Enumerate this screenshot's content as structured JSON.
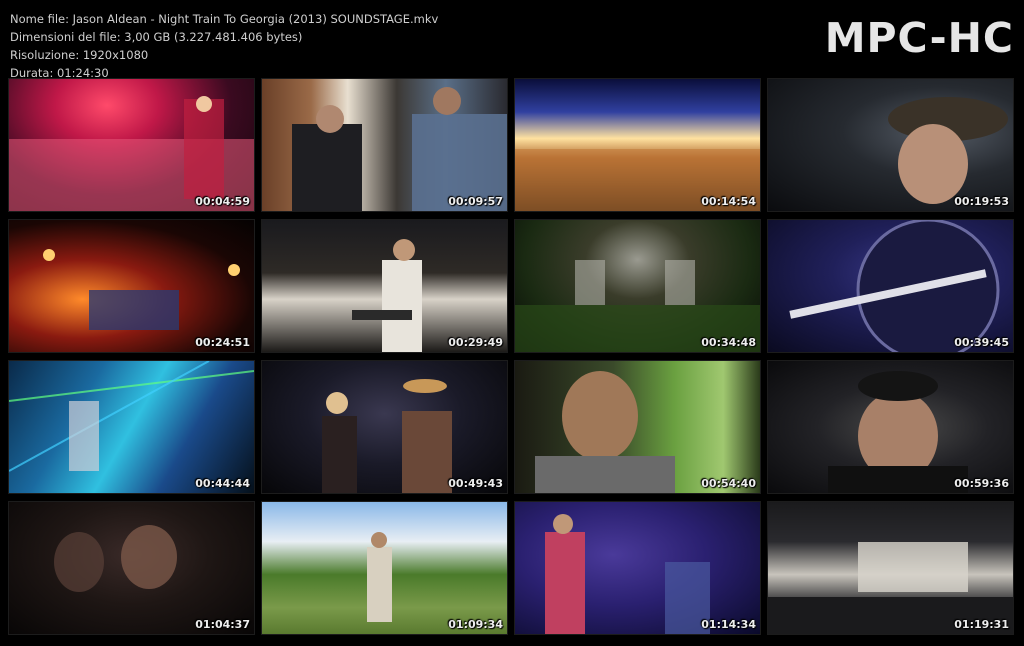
{
  "file_info": {
    "name": "Nome file: Jason Aldean - Night Train To Georgia (2013) SOUNDSTAGE.mkv",
    "size": "Dimensioni del file: 3,00 GB (3.227.481.406 bytes)",
    "resolution": "Risoluzione: 1920x1080",
    "duration": "Durata: 01:24:30"
  },
  "logo_text": "MPC-HC",
  "thumbnails": [
    {
      "timestamp": "00:04:59"
    },
    {
      "timestamp": "00:09:57"
    },
    {
      "timestamp": "00:14:54"
    },
    {
      "timestamp": "00:19:53"
    },
    {
      "timestamp": "00:24:51"
    },
    {
      "timestamp": "00:29:49"
    },
    {
      "timestamp": "00:34:48"
    },
    {
      "timestamp": "00:39:45"
    },
    {
      "timestamp": "00:44:44"
    },
    {
      "timestamp": "00:49:43"
    },
    {
      "timestamp": "00:54:40"
    },
    {
      "timestamp": "00:59:36"
    },
    {
      "timestamp": "01:04:37"
    },
    {
      "timestamp": "01:09:34"
    },
    {
      "timestamp": "01:14:34"
    },
    {
      "timestamp": "01:19:31"
    }
  ],
  "colors": {
    "background": "#000000",
    "text": "#cfcfcf",
    "logo": "#e6e6e6"
  }
}
